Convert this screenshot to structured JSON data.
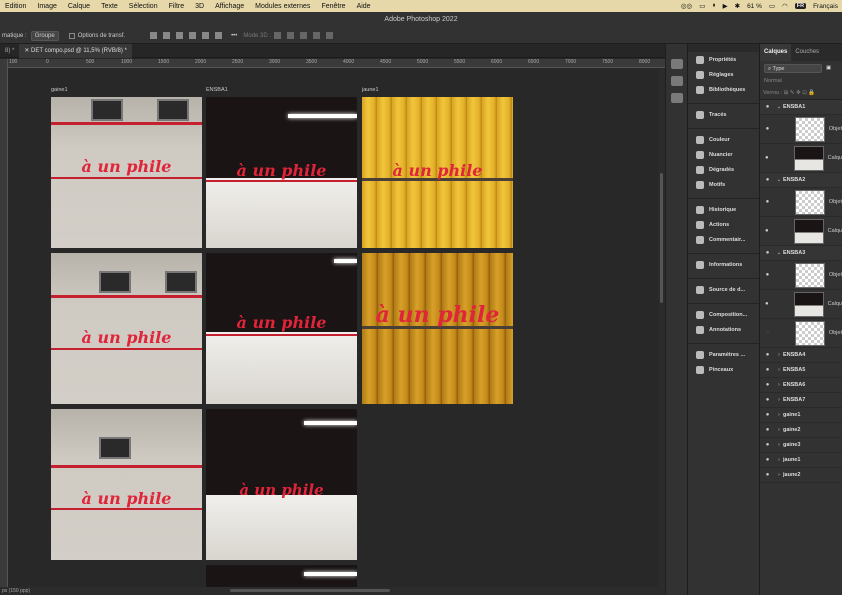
{
  "menubar": {
    "items": [
      "Edition",
      "Image",
      "Calque",
      "Texte",
      "Sélection",
      "Filtre",
      "3D",
      "Affichage",
      "Modules externes",
      "Fenêtre",
      "Aide"
    ],
    "battery": "61 %",
    "lang_badge": "FR",
    "lang_label": "Français"
  },
  "app_title": "Adobe Photoshop 2022",
  "options": {
    "auto_select_label": "matique :",
    "auto_select_value": "Groupe",
    "transform_label": "Options de transf.",
    "mode3d_label": "Mode 3D :"
  },
  "tabs": [
    "8) *",
    "DET compo.psd @ 11,5% (RVB/8) *"
  ],
  "ruler": {
    "labels": [
      "100",
      "0",
      "500",
      "1000",
      "1500",
      "2000",
      "2500",
      "3000",
      "3500",
      "4000",
      "4500",
      "5000",
      "5500",
      "6000",
      "6500",
      "7000",
      "7500",
      "8000",
      "8500",
      "9000"
    ]
  },
  "canvas": {
    "columns": [
      {
        "label": "gaine1",
        "caption": "à un phile"
      },
      {
        "label": "ENSBA1",
        "caption": "à un phile"
      },
      {
        "label": "jaune1",
        "caption": "à un phile"
      }
    ],
    "captions": {
      "gaine2": "à un phile",
      "gaine3": "à un phile",
      "ensba2": "à un phile",
      "ensba3": "à un phile",
      "jaune2": "à un phile"
    }
  },
  "status": "px (150 ppp)",
  "dock": {
    "group1": [
      "Propriétés",
      "Réglages",
      "Bibliothèques"
    ],
    "group2": [
      "Tracés"
    ],
    "group3": [
      "Couleur",
      "Nuancier",
      "Dégradés",
      "Motifs"
    ],
    "group4": [
      "Historique",
      "Actions",
      "Commentair..."
    ],
    "group5": [
      "Informations"
    ],
    "group6": [
      "Source de d..."
    ],
    "group7": [
      "Composition...",
      "Annotations"
    ],
    "group8": [
      "Paramètres ...",
      "Pinceaux"
    ]
  },
  "layers_panel": {
    "tab_active": "Calques",
    "tab_other": "Couches",
    "filter_type": "Type",
    "blend_mode": "Normal",
    "lock_label": "Verrou :",
    "groups_open": [
      {
        "name": "ENSBA1",
        "children": [
          "Objet",
          "Calqu"
        ]
      },
      {
        "name": "ENSBA2",
        "children": [
          "Objet",
          "Calqu"
        ]
      },
      {
        "name": "ENSBA3",
        "children": [
          "Objet",
          "Calqu",
          "Objet"
        ]
      }
    ],
    "groups_closed": [
      "ENSBA4",
      "ENSBA5",
      "ENSBA6",
      "ENSBA7",
      "gaine1",
      "gaine2",
      "gaine3",
      "jaune1",
      "jaune2"
    ]
  }
}
